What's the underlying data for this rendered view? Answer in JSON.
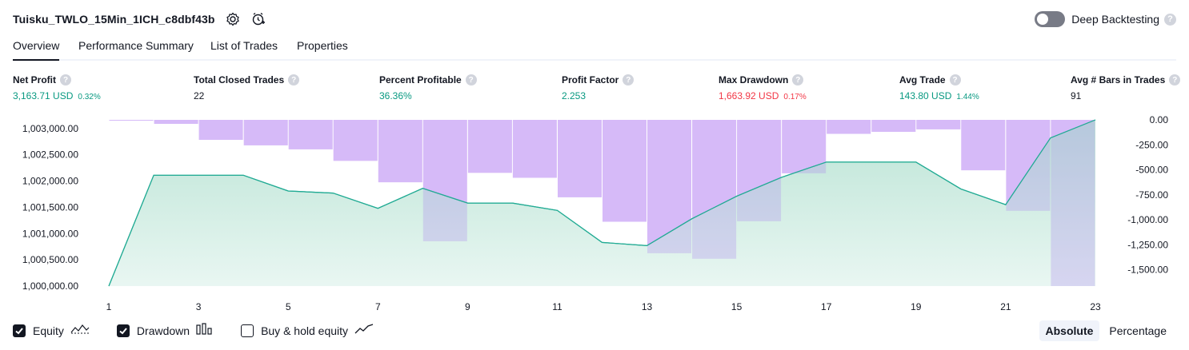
{
  "header": {
    "title": "Tuisku_TWLO_15Min_1ICH_c8dbf43b",
    "deep_backtesting_label": "Deep Backtesting",
    "help_glyph": "?"
  },
  "tabs": [
    {
      "label": "Overview",
      "active": true
    },
    {
      "label": "Performance Summary",
      "active": false
    },
    {
      "label": "List of Trades",
      "active": false
    },
    {
      "label": "Properties",
      "active": false
    }
  ],
  "metrics": [
    {
      "label": "Net Profit",
      "value": "3,163.71 USD",
      "pct": "0.32%",
      "color": "green"
    },
    {
      "label": "Total Closed Trades",
      "value": "22",
      "pct": "",
      "color": "dark"
    },
    {
      "label": "Percent Profitable",
      "value": "36.36%",
      "pct": "",
      "color": "green"
    },
    {
      "label": "Profit Factor",
      "value": "2.253",
      "pct": "",
      "color": "green"
    },
    {
      "label": "Max Drawdown",
      "value": "1,663.92 USD",
      "pct": "0.17%",
      "color": "red"
    },
    {
      "label": "Avg Trade",
      "value": "143.80 USD",
      "pct": "1.44%",
      "color": "green"
    },
    {
      "label": "Avg # Bars in Trades",
      "value": "91",
      "pct": "",
      "color": "dark"
    }
  ],
  "chart_data": {
    "type": "line",
    "left_axis": {
      "ticks": [
        1000000,
        1000500,
        1001000,
        1001500,
        1002000,
        1002500,
        1003000
      ],
      "tick_labels": [
        "1,000,000.00",
        "1,000,500.00",
        "1,001,000.00",
        "1,001,500.00",
        "1,002,000.00",
        "1,002,500.00",
        "1,003,000.00"
      ],
      "range": [
        1000000,
        1003163.71
      ]
    },
    "right_axis": {
      "ticks": [
        0,
        -250,
        -500,
        -750,
        -1000,
        -1250,
        -1500
      ],
      "tick_labels": [
        "0.00",
        "-250.00",
        "-500.00",
        "-750.00",
        "-1,000.00",
        "-1,250.00",
        "-1,500.00"
      ],
      "range": [
        -1663.92,
        0
      ]
    },
    "x_ticks": [
      1,
      3,
      5,
      7,
      9,
      11,
      13,
      15,
      17,
      19,
      21,
      23
    ],
    "x_range": [
      1,
      23
    ],
    "series": [
      {
        "name": "Equity",
        "color": "#22ab94",
        "x": [
          1,
          2,
          3,
          4,
          5,
          6,
          7,
          8,
          9,
          10,
          11,
          12,
          13,
          14,
          15,
          16,
          17,
          18,
          19,
          20,
          21,
          22,
          23
        ],
        "values": [
          1000000,
          1002110,
          1002110,
          1002110,
          1001810,
          1001770,
          1001480,
          1001860,
          1001580,
          1001580,
          1001440,
          1000830,
          1000770,
          1001280,
          1001710,
          1002070,
          1002360,
          1002360,
          1002360,
          1001850,
          1001550,
          1002820,
          1003163.71
        ]
      },
      {
        "name": "Drawdown",
        "color": "#c38cff",
        "x": [
          1,
          2,
          3,
          4,
          5,
          6,
          7,
          8,
          9,
          10,
          11,
          12,
          13,
          14,
          15,
          16,
          17,
          18,
          19,
          20,
          21,
          22
        ],
        "values": [
          -5,
          -40,
          -200,
          -255,
          -295,
          -410,
          -625,
          -1215,
          -530,
          -580,
          -775,
          -1020,
          -1335,
          -1390,
          -1015,
          -535,
          -140,
          -120,
          -95,
          -505,
          -910,
          -1663.92
        ]
      }
    ]
  },
  "legend": [
    {
      "label": "Equity",
      "checked": true,
      "icon": "equity-line-icon"
    },
    {
      "label": "Drawdown",
      "checked": true,
      "icon": "drawdown-bars-icon"
    },
    {
      "label": "Buy & hold equity",
      "checked": false,
      "icon": "buy-hold-line-icon"
    }
  ],
  "modes": [
    {
      "label": "Absolute",
      "active": true
    },
    {
      "label": "Percentage",
      "active": false
    }
  ]
}
